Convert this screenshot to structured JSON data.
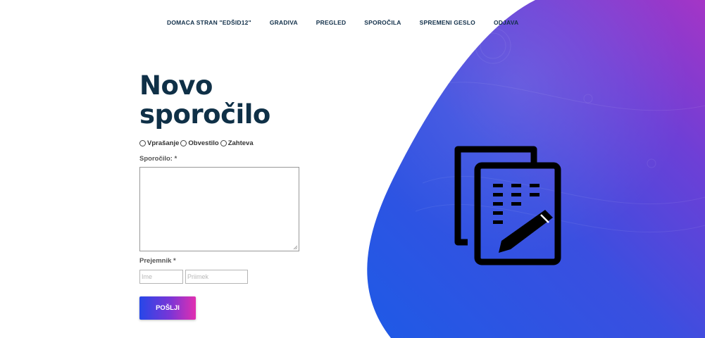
{
  "nav": {
    "items": [
      "DOMACA STRAN \"EDŠID12\"",
      "GRADIVA",
      "PREGLED",
      "SPOROČILA",
      "SPREMENI GESLO",
      "ODJAVA"
    ]
  },
  "page": {
    "title_line1": "Novo",
    "title_line2": "sporočilo"
  },
  "form": {
    "type_options": [
      "Vprašanje",
      "Obvestilo",
      "Zahteva"
    ],
    "message_label": "Sporočilo: *",
    "message_value": "",
    "recipient_label": "Prejemnik *",
    "first_name_placeholder": "Ime",
    "last_name_placeholder": "Priimek",
    "submit_label": "POŠLJI"
  },
  "colors": {
    "nav_text": "#12304a",
    "title": "#0f3047",
    "blob_blue": "#1e5ae6",
    "blob_purple": "#9b35cc",
    "button_start": "#2647e8",
    "button_end": "#e12fb0"
  },
  "icons": {
    "hero": "document-edit-icon"
  }
}
